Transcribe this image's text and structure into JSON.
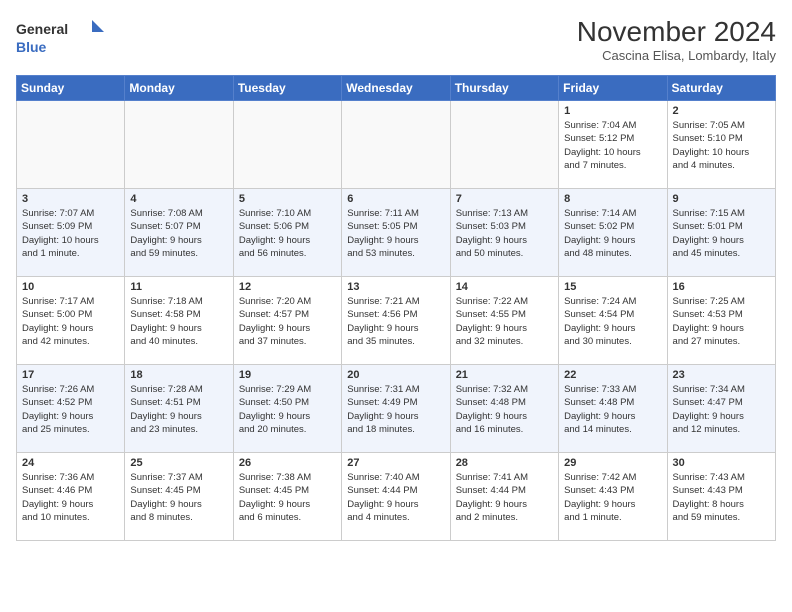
{
  "logo": {
    "line1": "General",
    "line2": "Blue"
  },
  "title": "November 2024",
  "location": "Cascina Elisa, Lombardy, Italy",
  "days_of_week": [
    "Sunday",
    "Monday",
    "Tuesday",
    "Wednesday",
    "Thursday",
    "Friday",
    "Saturday"
  ],
  "weeks": [
    [
      {
        "day": "",
        "info": ""
      },
      {
        "day": "",
        "info": ""
      },
      {
        "day": "",
        "info": ""
      },
      {
        "day": "",
        "info": ""
      },
      {
        "day": "",
        "info": ""
      },
      {
        "day": "1",
        "info": "Sunrise: 7:04 AM\nSunset: 5:12 PM\nDaylight: 10 hours\nand 7 minutes."
      },
      {
        "day": "2",
        "info": "Sunrise: 7:05 AM\nSunset: 5:10 PM\nDaylight: 10 hours\nand 4 minutes."
      }
    ],
    [
      {
        "day": "3",
        "info": "Sunrise: 7:07 AM\nSunset: 5:09 PM\nDaylight: 10 hours\nand 1 minute."
      },
      {
        "day": "4",
        "info": "Sunrise: 7:08 AM\nSunset: 5:07 PM\nDaylight: 9 hours\nand 59 minutes."
      },
      {
        "day": "5",
        "info": "Sunrise: 7:10 AM\nSunset: 5:06 PM\nDaylight: 9 hours\nand 56 minutes."
      },
      {
        "day": "6",
        "info": "Sunrise: 7:11 AM\nSunset: 5:05 PM\nDaylight: 9 hours\nand 53 minutes."
      },
      {
        "day": "7",
        "info": "Sunrise: 7:13 AM\nSunset: 5:03 PM\nDaylight: 9 hours\nand 50 minutes."
      },
      {
        "day": "8",
        "info": "Sunrise: 7:14 AM\nSunset: 5:02 PM\nDaylight: 9 hours\nand 48 minutes."
      },
      {
        "day": "9",
        "info": "Sunrise: 7:15 AM\nSunset: 5:01 PM\nDaylight: 9 hours\nand 45 minutes."
      }
    ],
    [
      {
        "day": "10",
        "info": "Sunrise: 7:17 AM\nSunset: 5:00 PM\nDaylight: 9 hours\nand 42 minutes."
      },
      {
        "day": "11",
        "info": "Sunrise: 7:18 AM\nSunset: 4:58 PM\nDaylight: 9 hours\nand 40 minutes."
      },
      {
        "day": "12",
        "info": "Sunrise: 7:20 AM\nSunset: 4:57 PM\nDaylight: 9 hours\nand 37 minutes."
      },
      {
        "day": "13",
        "info": "Sunrise: 7:21 AM\nSunset: 4:56 PM\nDaylight: 9 hours\nand 35 minutes."
      },
      {
        "day": "14",
        "info": "Sunrise: 7:22 AM\nSunset: 4:55 PM\nDaylight: 9 hours\nand 32 minutes."
      },
      {
        "day": "15",
        "info": "Sunrise: 7:24 AM\nSunset: 4:54 PM\nDaylight: 9 hours\nand 30 minutes."
      },
      {
        "day": "16",
        "info": "Sunrise: 7:25 AM\nSunset: 4:53 PM\nDaylight: 9 hours\nand 27 minutes."
      }
    ],
    [
      {
        "day": "17",
        "info": "Sunrise: 7:26 AM\nSunset: 4:52 PM\nDaylight: 9 hours\nand 25 minutes."
      },
      {
        "day": "18",
        "info": "Sunrise: 7:28 AM\nSunset: 4:51 PM\nDaylight: 9 hours\nand 23 minutes."
      },
      {
        "day": "19",
        "info": "Sunrise: 7:29 AM\nSunset: 4:50 PM\nDaylight: 9 hours\nand 20 minutes."
      },
      {
        "day": "20",
        "info": "Sunrise: 7:31 AM\nSunset: 4:49 PM\nDaylight: 9 hours\nand 18 minutes."
      },
      {
        "day": "21",
        "info": "Sunrise: 7:32 AM\nSunset: 4:48 PM\nDaylight: 9 hours\nand 16 minutes."
      },
      {
        "day": "22",
        "info": "Sunrise: 7:33 AM\nSunset: 4:48 PM\nDaylight: 9 hours\nand 14 minutes."
      },
      {
        "day": "23",
        "info": "Sunrise: 7:34 AM\nSunset: 4:47 PM\nDaylight: 9 hours\nand 12 minutes."
      }
    ],
    [
      {
        "day": "24",
        "info": "Sunrise: 7:36 AM\nSunset: 4:46 PM\nDaylight: 9 hours\nand 10 minutes."
      },
      {
        "day": "25",
        "info": "Sunrise: 7:37 AM\nSunset: 4:45 PM\nDaylight: 9 hours\nand 8 minutes."
      },
      {
        "day": "26",
        "info": "Sunrise: 7:38 AM\nSunset: 4:45 PM\nDaylight: 9 hours\nand 6 minutes."
      },
      {
        "day": "27",
        "info": "Sunrise: 7:40 AM\nSunset: 4:44 PM\nDaylight: 9 hours\nand 4 minutes."
      },
      {
        "day": "28",
        "info": "Sunrise: 7:41 AM\nSunset: 4:44 PM\nDaylight: 9 hours\nand 2 minutes."
      },
      {
        "day": "29",
        "info": "Sunrise: 7:42 AM\nSunset: 4:43 PM\nDaylight: 9 hours\nand 1 minute."
      },
      {
        "day": "30",
        "info": "Sunrise: 7:43 AM\nSunset: 4:43 PM\nDaylight: 8 hours\nand 59 minutes."
      }
    ]
  ]
}
